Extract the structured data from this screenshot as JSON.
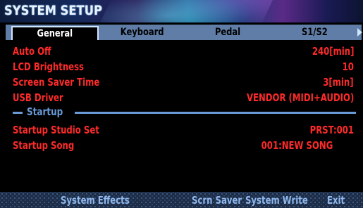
{
  "header": {
    "title": "SYSTEM SETUP"
  },
  "tabs": [
    {
      "label": "General",
      "active": true
    },
    {
      "label": "Keyboard",
      "active": false
    },
    {
      "label": "Pedal",
      "active": false
    },
    {
      "label": "S1/S2",
      "active": false
    }
  ],
  "params": [
    {
      "label": "Auto Off",
      "value": "240[min]"
    },
    {
      "label": "LCD Brightness",
      "value": "10"
    },
    {
      "label": "Screen Saver Time",
      "value": "3[min]"
    },
    {
      "label": "USB Driver",
      "value": "VENDOR (MIDI+AUDIO)"
    }
  ],
  "startup_section": {
    "title": "Startup",
    "params": [
      {
        "label": "Startup Studio Set",
        "value": "PRST:001"
      },
      {
        "label": "Startup Song",
        "value": "001:NEW SONG"
      }
    ]
  },
  "function_bar": {
    "system_effects": "System Effects",
    "scrn_saver": "Scrn Saver",
    "system_write": "System Write",
    "exit": "Exit"
  },
  "colors": {
    "param_text": "#ff2a2a",
    "section_accent": "#6a9ad8",
    "tab_bar": "#5f7da6",
    "function_text": "#8fb8ee"
  }
}
